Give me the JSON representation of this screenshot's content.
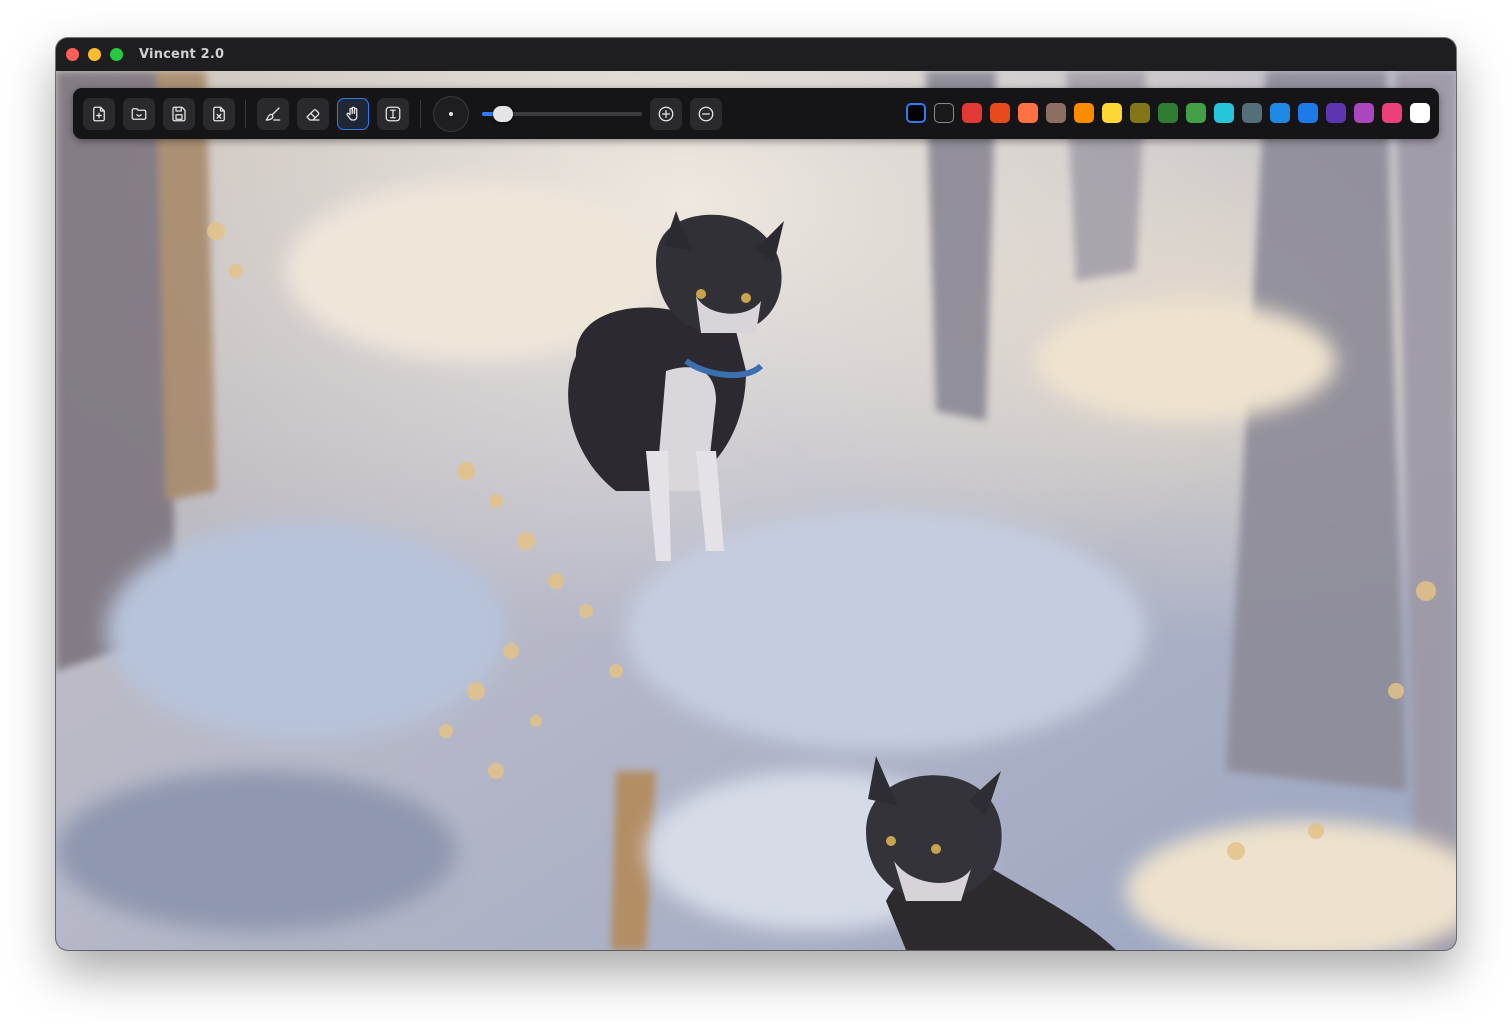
{
  "window": {
    "title": "Vincent 2.0",
    "traffic_lights": {
      "close": "#fe5f57",
      "minimize": "#febc2e",
      "zoom": "#28c840"
    }
  },
  "canvas": {
    "content": "painting-of-two-cats-in-snowy-forest"
  },
  "toolbar": {
    "file_tools": [
      {
        "name": "new-file-button",
        "icon": "file-plus-icon"
      },
      {
        "name": "open-file-button",
        "icon": "folder-open-icon"
      },
      {
        "name": "save-button",
        "icon": "floppy-disk-icon"
      },
      {
        "name": "close-file-button",
        "icon": "file-x-icon"
      }
    ],
    "draw_tools": [
      {
        "name": "brush-tool-button",
        "icon": "brush-icon",
        "active": false
      },
      {
        "name": "eraser-tool-button",
        "icon": "eraser-icon",
        "active": false
      },
      {
        "name": "pan-tool-button",
        "icon": "hand-icon",
        "active": true
      },
      {
        "name": "text-tool-button",
        "icon": "text-cursor-icon",
        "active": false
      }
    ],
    "brush_size": {
      "value": 0.08
    },
    "zoom_in_icon": "plus-circle-icon",
    "zoom_out_icon": "minus-circle-icon",
    "accent_color": "#2f7cf6"
  },
  "palette": {
    "selected_index": 0,
    "colors": [
      "#000000",
      "#1a1a1a",
      "#e53935",
      "#e8491c",
      "#ff7043",
      "#8d6e63",
      "#fb8c00",
      "#fdd835",
      "#827717",
      "#2e7d32",
      "#43a047",
      "#26c6da",
      "#546e7a",
      "#1e88e5",
      "#1e7ae8",
      "#5e35b1",
      "#ab47bc",
      "#ec407a",
      "#ffffff"
    ]
  }
}
